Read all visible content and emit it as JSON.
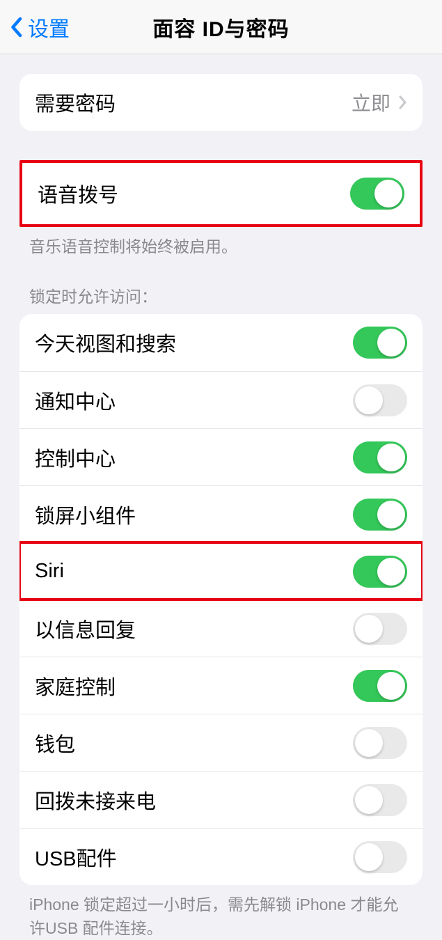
{
  "nav": {
    "back_label": "设置",
    "title": "面容 ID与密码"
  },
  "passcode": {
    "label": "需要密码",
    "value": "立即"
  },
  "voice_dial": {
    "label": "语音拨号",
    "on": true,
    "footer": "音乐语音控制将始终被启用。"
  },
  "lock_section": {
    "header": "锁定时允许访问：",
    "items": [
      {
        "label": "今天视图和搜索",
        "on": true
      },
      {
        "label": "通知中心",
        "on": false
      },
      {
        "label": "控制中心",
        "on": true
      },
      {
        "label": "锁屏小组件",
        "on": true
      },
      {
        "label": "Siri",
        "on": true
      },
      {
        "label": "以信息回复",
        "on": false
      },
      {
        "label": "家庭控制",
        "on": true
      },
      {
        "label": "钱包",
        "on": false
      },
      {
        "label": "回拨未接来电",
        "on": false
      },
      {
        "label": "USB配件",
        "on": false
      }
    ],
    "footer": "iPhone 锁定超过一小时后，需先解锁 iPhone 才能允许USB 配件连接。"
  }
}
